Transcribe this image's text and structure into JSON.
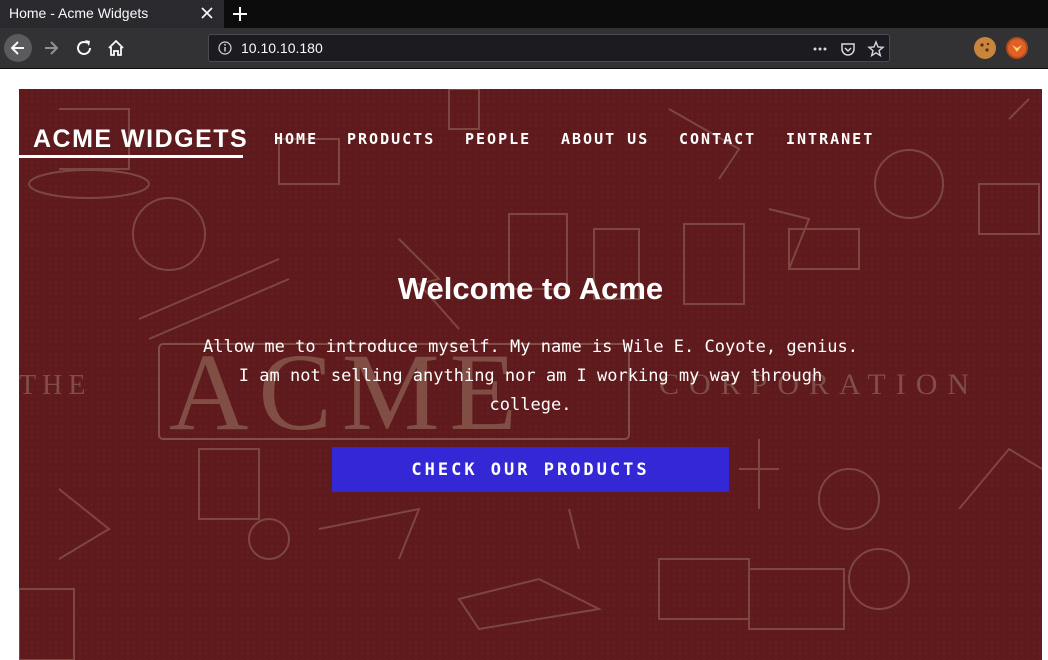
{
  "browser": {
    "tab": {
      "title": "Home - Acme Widgets",
      "close_icon": "close-icon"
    },
    "new_tab_icon": "plus-icon",
    "toolbar": {
      "back_icon": "back-arrow-icon",
      "forward_icon": "forward-arrow-icon",
      "reload_icon": "reload-icon",
      "home_icon": "home-icon"
    },
    "urlbar": {
      "info_icon": "info-icon",
      "url": "10.10.10.180",
      "actions": [
        "more-icon",
        "pocket-icon",
        "star-icon"
      ]
    },
    "extensions": [
      "cookie-extension-icon",
      "fox-extension-icon"
    ]
  },
  "site": {
    "brand": "ACME WIDGETS",
    "nav": [
      {
        "label": "HOME"
      },
      {
        "label": "PRODUCTS"
      },
      {
        "label": "PEOPLE"
      },
      {
        "label": "ABOUT US"
      },
      {
        "label": "CONTACT"
      },
      {
        "label": "INTRANET"
      }
    ],
    "hero": {
      "headline": "Welcome to Acme",
      "intro_lines": [
        "Allow me to introduce myself. My name is Wile E. Coyote, genius.",
        "I am not selling anything nor am I working my way through",
        "college."
      ],
      "cta": "CHECK OUR PRODUCTS",
      "background_text": "THE ACME CORPORATION"
    }
  },
  "colors": {
    "hero_background": "#5e1a1c",
    "cta_background": "#3327d6",
    "tab_background": "#2a2a2e",
    "toolbar_background": "#323234"
  }
}
